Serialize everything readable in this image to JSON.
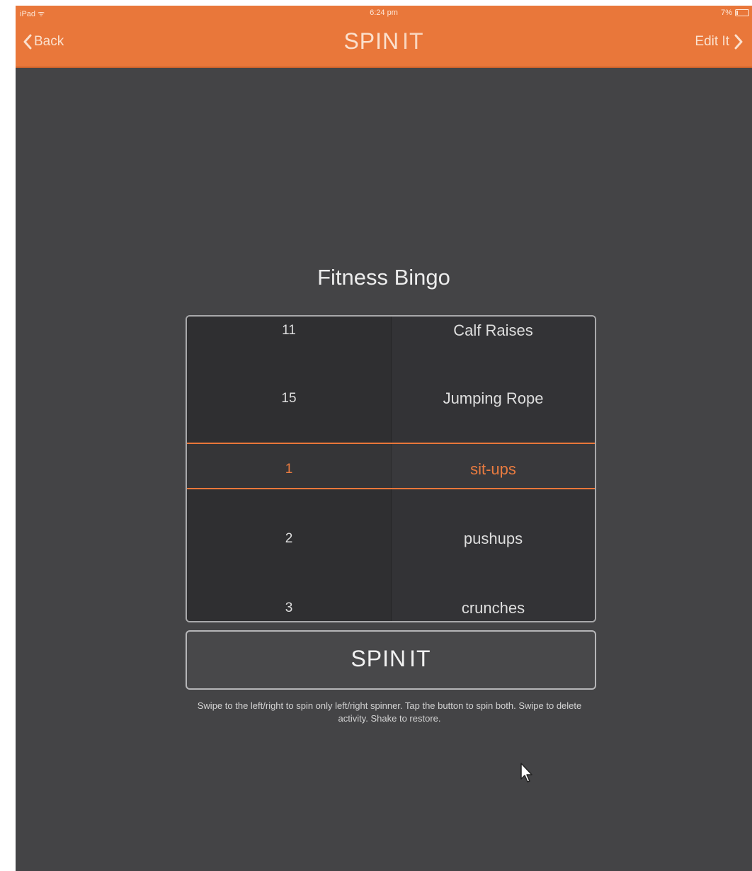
{
  "status_bar": {
    "carrier": "iPad ᯤ",
    "time": "6:24 pm",
    "battery": "7%"
  },
  "nav": {
    "back_label": "Back",
    "edit_label": "Edit It",
    "logo_main": "SPIN",
    "logo_sub": "IT"
  },
  "main": {
    "title": "Fitness Bingo"
  },
  "picker": {
    "left_column": [
      "11",
      "15",
      "1",
      "2",
      "3"
    ],
    "right_column": [
      "Calf Raises",
      "Jumping Rope",
      "sit-ups",
      "pushups",
      "crunches"
    ],
    "selected_index": 2
  },
  "spin_button": {
    "logo_main": "SPIN",
    "logo_sub": "IT"
  },
  "hint": {
    "text": "Swipe to the left/right to spin only left/right spinner. Tap the button to spin both. Swipe to delete activity. Shake to restore."
  },
  "colors": {
    "accent": "#e9773a",
    "background": "#444446",
    "picker_bg": "#333335"
  },
  "icons": {
    "back": "chevron-left-icon",
    "edit": "chevron-right-icon",
    "battery": "battery-icon",
    "cursor": "mouse-pointer-icon"
  }
}
